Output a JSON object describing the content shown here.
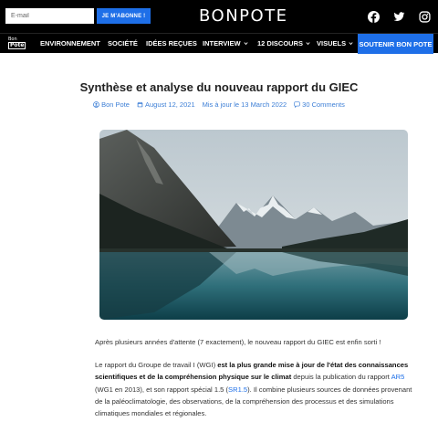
{
  "topbar": {
    "email_placeholder": "E-mail",
    "subscribe_label": "JE M'ABONNE !",
    "brand": "BONPOTE",
    "social": [
      "facebook-icon",
      "twitter-icon",
      "instagram-icon"
    ]
  },
  "navbar": {
    "logo_line1": "Bon",
    "logo_line2": "Pote",
    "items": [
      {
        "label": "ENVIRONNEMENT",
        "dropdown": false
      },
      {
        "label": "SOCIÉTÉ",
        "dropdown": false
      },
      {
        "label": "IDÉES REÇUES",
        "dropdown": false
      },
      {
        "label": "INTERVIEW",
        "dropdown": true
      },
      {
        "label": "12 DISCOURS",
        "dropdown": true
      },
      {
        "label": "VISUELS",
        "dropdown": true
      }
    ],
    "support_label": "SOUTENIR BON POTE"
  },
  "article": {
    "title": "Synthèse et analyse du nouveau rapport du GIEC",
    "meta": {
      "author": "Bon Pote",
      "date": "August 12, 2021",
      "updated": "Mis à jour le 13 March 2022",
      "comments": "30 Comments"
    },
    "hero_image": "mountain-lake-landscape",
    "p1": "Après plusieurs années d'attente (7 exactement), le nouveau rapport du GIEC est enfin sorti !",
    "p2": {
      "t1": "Le rapport du Groupe de travail I (WGI) ",
      "b1": "est la plus grande mise à jour de l'état des connaissances scientifiques et de la compréhension physique sur le climat",
      "t2": " depuis la publication du rapport ",
      "link1": "AR5",
      "t3": " (WG1 en 2013), et son rapport spécial 1.5 (",
      "link2": "SR1.5",
      "t4": "). Il combine plusieurs sources de données provenant de la paléoclimatologie, des observations, de la compréhension des processus et des simulations climatiques mondiales et régionales."
    }
  },
  "colors": {
    "accent": "#1e6fe8",
    "header_bg": "#000000",
    "meta_link": "#3d7fd6"
  }
}
